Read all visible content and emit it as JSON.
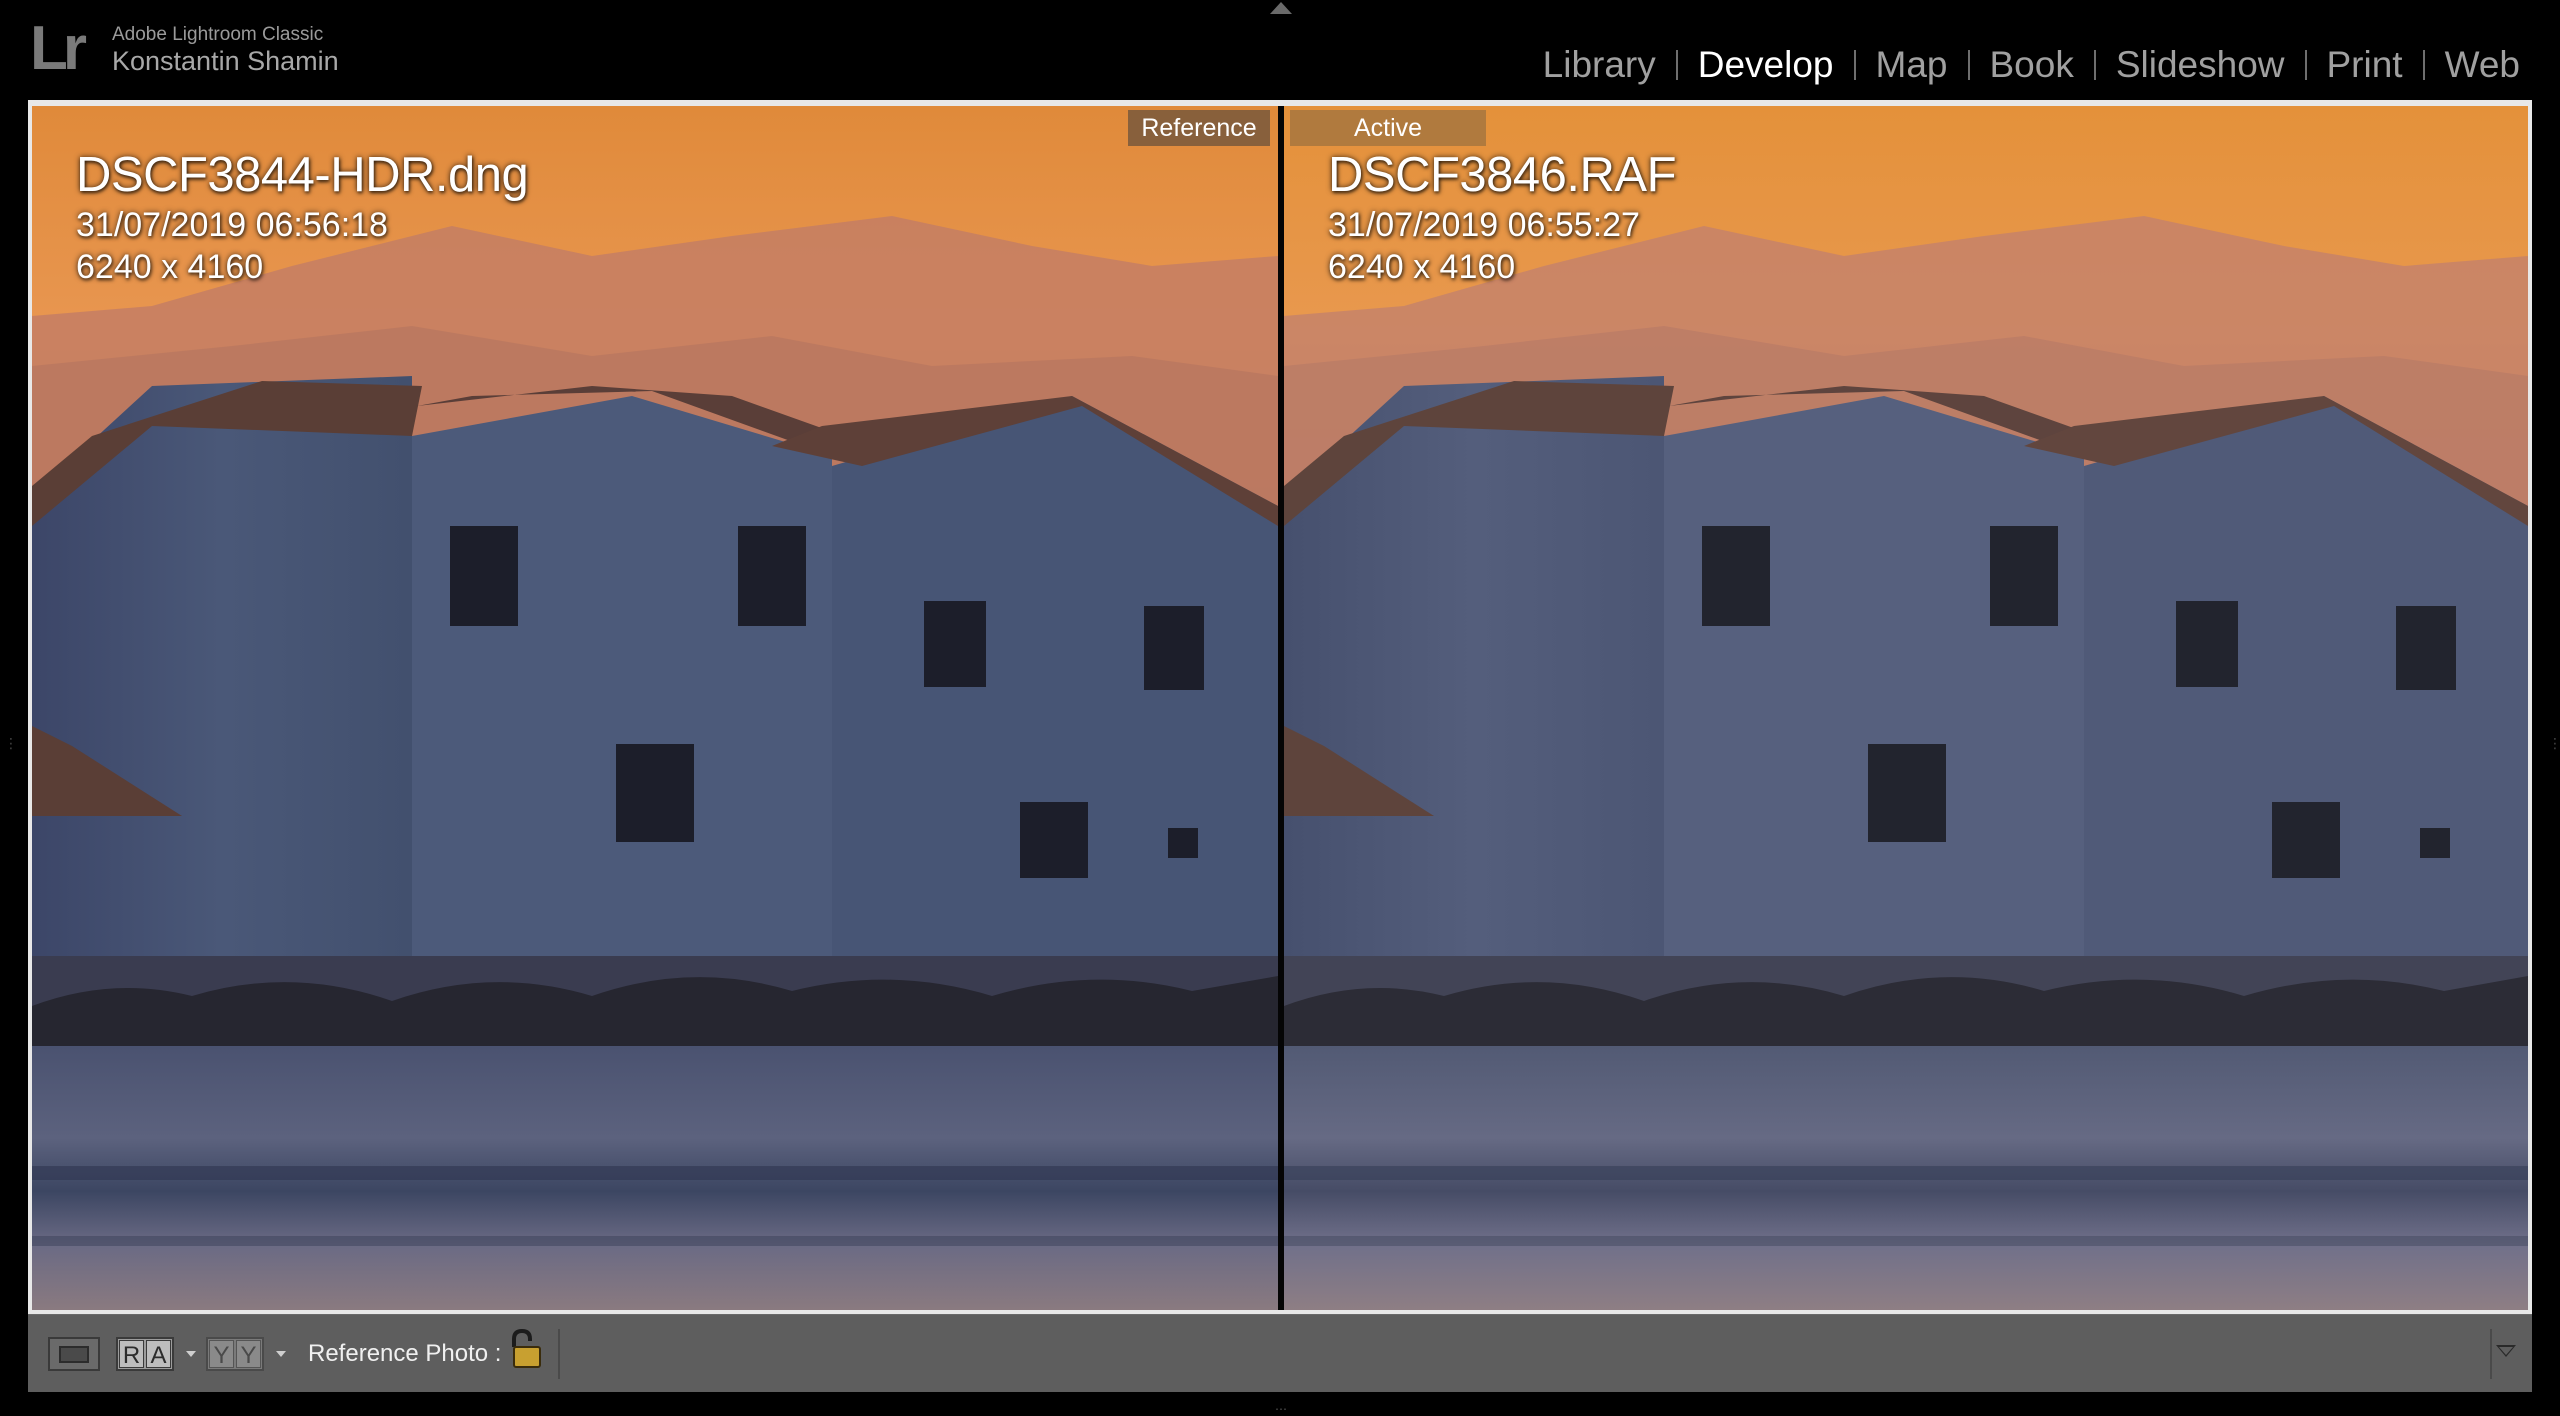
{
  "identity": {
    "logo": "Lr",
    "app_name": "Adobe Lightroom Classic",
    "user_name": "Konstantin Shamin"
  },
  "modules": [
    {
      "label": "Library",
      "active": false
    },
    {
      "label": "Develop",
      "active": true
    },
    {
      "label": "Map",
      "active": false
    },
    {
      "label": "Book",
      "active": false
    },
    {
      "label": "Slideshow",
      "active": false
    },
    {
      "label": "Print",
      "active": false
    },
    {
      "label": "Web",
      "active": false
    }
  ],
  "reference_panel": {
    "tag": "Reference",
    "filename": "DSCF3844-HDR.dng",
    "datetime": "31/07/2019 06:56:18",
    "dimensions": "6240 x 4160"
  },
  "active_panel": {
    "tag": "Active",
    "filename": "DSCF3846.RAF",
    "datetime": "31/07/2019 06:55:27",
    "dimensions": "6240 x 4160"
  },
  "toolbar": {
    "view_icon": "loupe-view-icon",
    "ra_left": "R",
    "ra_right": "A",
    "yy_left": "Y",
    "yy_right": "Y",
    "reference_photo_label": "Reference Photo :",
    "lock_icon": "padlock-unlocked-icon",
    "menu_icon": "toolbar-menu-triangle-icon"
  },
  "colors": {
    "active_module": "#ffffff",
    "inactive_module": "#a0a0a0",
    "active_tag": "#b07a3e",
    "reference_tag": "#78583c",
    "toolbar_bg": "#5e5e5e",
    "sky_top": "#e38a3c",
    "house_wall": "#4a5878"
  }
}
